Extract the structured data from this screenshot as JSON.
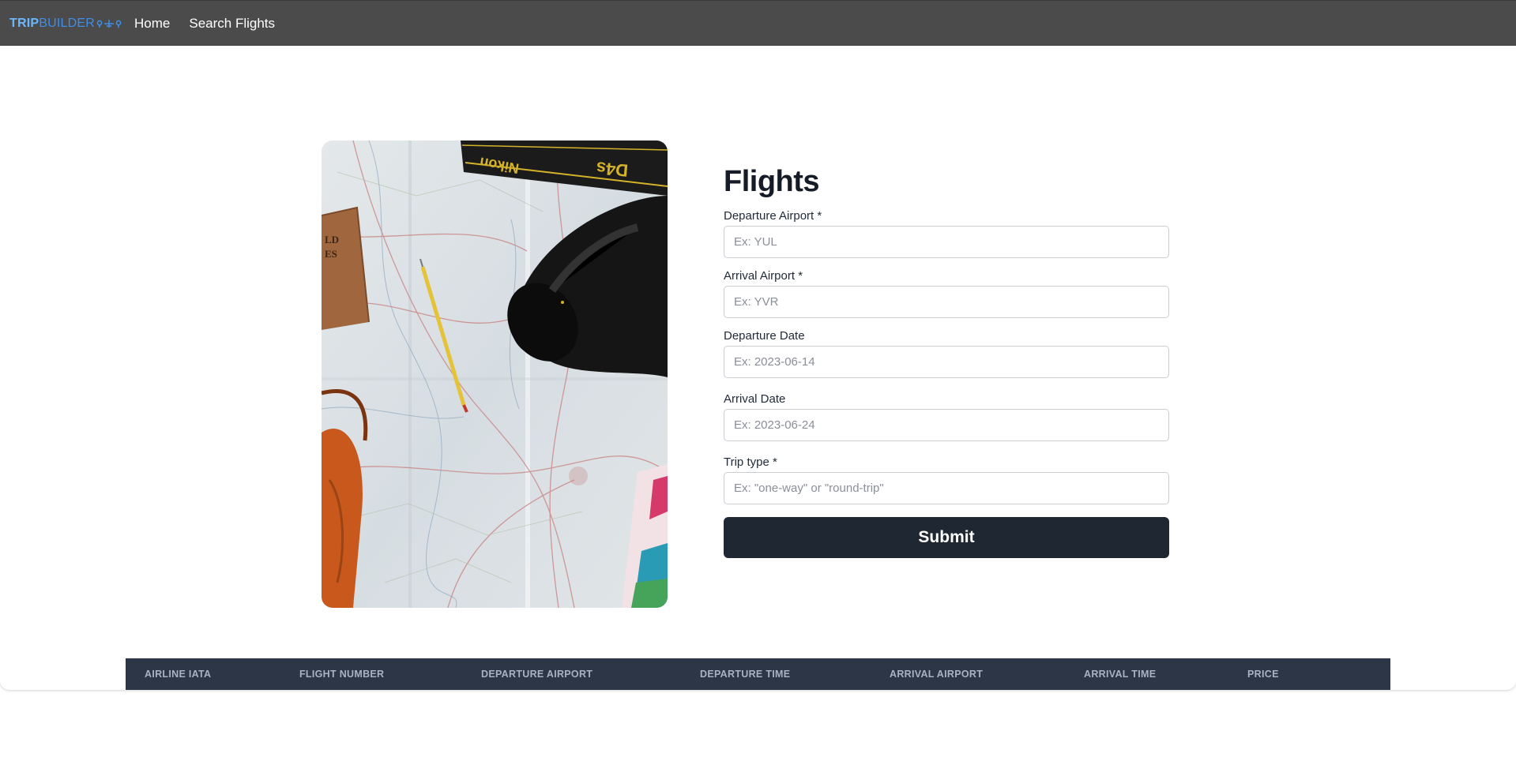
{
  "brand": {
    "part1": "TRIP",
    "part2": "BUILDER",
    "icon": "plane-route-icon"
  },
  "nav": {
    "home": "Home",
    "search_flights": "Search Flights"
  },
  "form": {
    "title": "Flights",
    "fields": [
      {
        "label": "Departure Airport *",
        "placeholder": "Ex: YUL"
      },
      {
        "label": "Arrival Airport *",
        "placeholder": "Ex: YVR"
      },
      {
        "label": "Departure Date",
        "placeholder": "Ex: 2023-06-14"
      },
      {
        "label": "Arrival Date",
        "placeholder": "Ex: 2023-06-24"
      },
      {
        "label": "Trip type *",
        "placeholder": "Ex: \"one-way\" or \"round-trip\""
      }
    ],
    "submit_label": "Submit"
  },
  "table": {
    "columns": [
      "AIRLINE IATA",
      "FLIGHT NUMBER",
      "DEPARTURE AIRPORT",
      "DEPARTURE TIME",
      "ARRIVAL AIRPORT",
      "ARRIVAL TIME",
      "PRICE"
    ]
  },
  "photo": {
    "strap_text": "Nikon",
    "model_text": "D4s"
  },
  "colors": {
    "navbar": "#4b4b4b",
    "brand_light": "#6cb8ff",
    "brand_dark": "#3f8ee8",
    "button": "#1f2732",
    "table_header": "#2d3646"
  }
}
